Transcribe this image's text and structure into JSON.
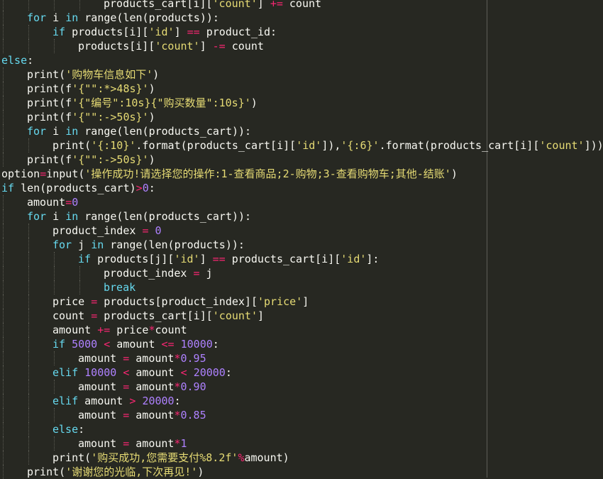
{
  "editor": {
    "language": "python",
    "theme_colors": {
      "background": "#272822",
      "text": "#f8f8f2",
      "keyword": "#66d9ef",
      "string": "#e6db74",
      "number": "#ae81ff",
      "operator": "#f92672",
      "ruler": "#5e5e58"
    },
    "lines": [
      {
        "indent": 4,
        "tokens": [
          [
            "pl",
            "products_cart[i]["
          ],
          [
            "str",
            "'count'"
          ],
          [
            "pl",
            "] "
          ],
          [
            "op",
            "+="
          ],
          [
            "pl",
            " count"
          ]
        ]
      },
      {
        "indent": 1,
        "tokens": [
          [
            "kw",
            "for"
          ],
          [
            "pl",
            " i "
          ],
          [
            "kw",
            "in"
          ],
          [
            "pl",
            " range(len(products)):"
          ]
        ]
      },
      {
        "indent": 2,
        "tokens": [
          [
            "kw",
            "if"
          ],
          [
            "pl",
            " products[i]["
          ],
          [
            "str",
            "'id'"
          ],
          [
            "pl",
            "] "
          ],
          [
            "op",
            "=="
          ],
          [
            "pl",
            " product_id:"
          ]
        ]
      },
      {
        "indent": 3,
        "tokens": [
          [
            "pl",
            "products[i]["
          ],
          [
            "str",
            "'count'"
          ],
          [
            "pl",
            "] "
          ],
          [
            "op",
            "-="
          ],
          [
            "pl",
            " count"
          ]
        ]
      },
      {
        "indent": 0,
        "tokens": [
          [
            "kw",
            "else"
          ],
          [
            "pl",
            ":"
          ]
        ]
      },
      {
        "indent": 1,
        "tokens": [
          [
            "pl",
            "print("
          ],
          [
            "str",
            "'购物车信息如下'"
          ],
          [
            "pl",
            ")"
          ]
        ]
      },
      {
        "indent": 1,
        "tokens": [
          [
            "pl",
            "print(f"
          ],
          [
            "str",
            "'{\"\":*>48s}'"
          ],
          [
            "pl",
            ")"
          ]
        ]
      },
      {
        "indent": 1,
        "tokens": [
          [
            "pl",
            "print(f"
          ],
          [
            "str",
            "'{\"编号\":10s}{\"购买数量\":10s}'"
          ],
          [
            "pl",
            ")"
          ]
        ]
      },
      {
        "indent": 1,
        "tokens": [
          [
            "pl",
            "print(f"
          ],
          [
            "str",
            "'{\"\":->50s}'"
          ],
          [
            "pl",
            ")"
          ]
        ]
      },
      {
        "indent": 1,
        "tokens": [
          [
            "kw",
            "for"
          ],
          [
            "pl",
            " i "
          ],
          [
            "kw",
            "in"
          ],
          [
            "pl",
            " range(len(products_cart)):"
          ]
        ]
      },
      {
        "indent": 2,
        "tokens": [
          [
            "pl",
            "print("
          ],
          [
            "str",
            "'{:10}'"
          ],
          [
            "pl",
            ".format(products_cart[i]["
          ],
          [
            "str",
            "'id'"
          ],
          [
            "pl",
            "]),"
          ],
          [
            "str",
            "'{:6}'"
          ],
          [
            "pl",
            ".format(products_cart[i]["
          ],
          [
            "str",
            "'count'"
          ],
          [
            "pl",
            "]))"
          ]
        ]
      },
      {
        "indent": 1,
        "tokens": [
          [
            "pl",
            "print(f"
          ],
          [
            "str",
            "'{\"\":->50s}'"
          ],
          [
            "pl",
            ")"
          ]
        ]
      },
      {
        "indent": 0,
        "tokens": [
          [
            "pl",
            "option"
          ],
          [
            "op",
            "="
          ],
          [
            "pl",
            "input("
          ],
          [
            "str",
            "'操作成功!请选择您的操作:1-查看商品;2-购物;3-查看购物车;其他-结账'"
          ],
          [
            "pl",
            ")"
          ]
        ]
      },
      {
        "indent": 0,
        "tokens": [
          [
            "kw",
            "if"
          ],
          [
            "pl",
            " len(products_cart)"
          ],
          [
            "op",
            ">"
          ],
          [
            "num",
            "0"
          ],
          [
            "pl",
            ":"
          ]
        ]
      },
      {
        "indent": 1,
        "tokens": [
          [
            "pl",
            "amount"
          ],
          [
            "op",
            "="
          ],
          [
            "num",
            "0"
          ]
        ]
      },
      {
        "indent": 1,
        "tokens": [
          [
            "kw",
            "for"
          ],
          [
            "pl",
            " i "
          ],
          [
            "kw",
            "in"
          ],
          [
            "pl",
            " range(len(products_cart)):"
          ]
        ]
      },
      {
        "indent": 2,
        "tokens": [
          [
            "pl",
            "product_index "
          ],
          [
            "op",
            "="
          ],
          [
            "pl",
            " "
          ],
          [
            "num",
            "0"
          ]
        ]
      },
      {
        "indent": 2,
        "tokens": [
          [
            "kw",
            "for"
          ],
          [
            "pl",
            " j "
          ],
          [
            "kw",
            "in"
          ],
          [
            "pl",
            " range(len(products)):"
          ]
        ]
      },
      {
        "indent": 3,
        "tokens": [
          [
            "kw",
            "if"
          ],
          [
            "pl",
            " products[j]["
          ],
          [
            "str",
            "'id'"
          ],
          [
            "pl",
            "] "
          ],
          [
            "op",
            "=="
          ],
          [
            "pl",
            " products_cart[i]["
          ],
          [
            "str",
            "'id'"
          ],
          [
            "pl",
            "]:"
          ]
        ]
      },
      {
        "indent": 4,
        "tokens": [
          [
            "pl",
            "product_index "
          ],
          [
            "op",
            "="
          ],
          [
            "pl",
            " j"
          ]
        ]
      },
      {
        "indent": 4,
        "tokens": [
          [
            "kw",
            "break"
          ]
        ]
      },
      {
        "indent": 2,
        "tokens": [
          [
            "pl",
            "price "
          ],
          [
            "op",
            "="
          ],
          [
            "pl",
            " products[product_index]["
          ],
          [
            "str",
            "'price'"
          ],
          [
            "pl",
            "]"
          ]
        ]
      },
      {
        "indent": 2,
        "tokens": [
          [
            "pl",
            "count "
          ],
          [
            "op",
            "="
          ],
          [
            "pl",
            " products_cart[i]["
          ],
          [
            "str",
            "'count'"
          ],
          [
            "pl",
            "]"
          ]
        ]
      },
      {
        "indent": 2,
        "tokens": [
          [
            "pl",
            "amount "
          ],
          [
            "op",
            "+="
          ],
          [
            "pl",
            " price"
          ],
          [
            "op",
            "*"
          ],
          [
            "pl",
            "count"
          ]
        ]
      },
      {
        "indent": 2,
        "tokens": [
          [
            "kw",
            "if"
          ],
          [
            "pl",
            " "
          ],
          [
            "num",
            "5000"
          ],
          [
            "pl",
            " "
          ],
          [
            "op",
            "<"
          ],
          [
            "pl",
            " amount "
          ],
          [
            "op",
            "<="
          ],
          [
            "pl",
            " "
          ],
          [
            "num",
            "10000"
          ],
          [
            "pl",
            ":"
          ]
        ]
      },
      {
        "indent": 3,
        "tokens": [
          [
            "pl",
            "amount "
          ],
          [
            "op",
            "="
          ],
          [
            "pl",
            " amount"
          ],
          [
            "op",
            "*"
          ],
          [
            "num",
            "0.95"
          ]
        ]
      },
      {
        "indent": 2,
        "tokens": [
          [
            "kw",
            "elif"
          ],
          [
            "pl",
            " "
          ],
          [
            "num",
            "10000"
          ],
          [
            "pl",
            " "
          ],
          [
            "op",
            "<"
          ],
          [
            "pl",
            " amount "
          ],
          [
            "op",
            "<"
          ],
          [
            "pl",
            " "
          ],
          [
            "num",
            "20000"
          ],
          [
            "pl",
            ":"
          ]
        ]
      },
      {
        "indent": 3,
        "tokens": [
          [
            "pl",
            "amount "
          ],
          [
            "op",
            "="
          ],
          [
            "pl",
            " amount"
          ],
          [
            "op",
            "*"
          ],
          [
            "num",
            "0.90"
          ]
        ]
      },
      {
        "indent": 2,
        "tokens": [
          [
            "kw",
            "elif"
          ],
          [
            "pl",
            " amount "
          ],
          [
            "op",
            ">"
          ],
          [
            "pl",
            " "
          ],
          [
            "num",
            "20000"
          ],
          [
            "pl",
            ":"
          ]
        ]
      },
      {
        "indent": 3,
        "tokens": [
          [
            "pl",
            "amount "
          ],
          [
            "op",
            "="
          ],
          [
            "pl",
            " amount"
          ],
          [
            "op",
            "*"
          ],
          [
            "num",
            "0.85"
          ]
        ]
      },
      {
        "indent": 2,
        "tokens": [
          [
            "kw",
            "else"
          ],
          [
            "pl",
            ":"
          ]
        ]
      },
      {
        "indent": 3,
        "tokens": [
          [
            "pl",
            "amount "
          ],
          [
            "op",
            "="
          ],
          [
            "pl",
            " amount"
          ],
          [
            "op",
            "*"
          ],
          [
            "num",
            "1"
          ]
        ]
      },
      {
        "indent": 2,
        "tokens": [
          [
            "pl",
            "print("
          ],
          [
            "str",
            "'购买成功,您需要支付%8.2f'"
          ],
          [
            "op",
            "%"
          ],
          [
            "pl",
            "amount)"
          ]
        ]
      },
      {
        "indent": 1,
        "tokens": [
          [
            "pl",
            "print("
          ],
          [
            "str",
            "'谢谢您的光临,下次再见!'"
          ],
          [
            "pl",
            ")"
          ]
        ]
      }
    ]
  }
}
